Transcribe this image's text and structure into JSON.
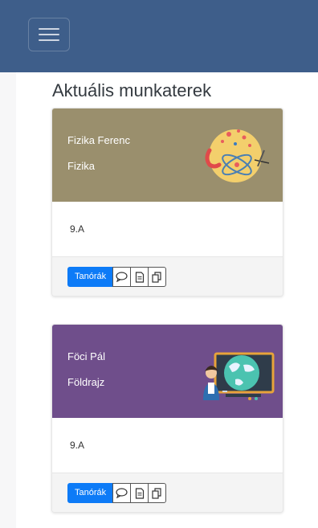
{
  "page_title": "Aktuális munkaterek",
  "cards": [
    {
      "teacher": "Fizika Ferenc",
      "subject": "Fizika",
      "class_name": "9.A",
      "header_color": "#9a8f6d",
      "illustration": "physics-atom-illustration",
      "buttons": {
        "primary": "Tanórák",
        "icons": [
          "chat-icon",
          "document-icon",
          "copy-icon"
        ]
      }
    },
    {
      "teacher": "Föci Pál",
      "subject": "Földrajz",
      "class_name": "9.A",
      "header_color": "#6f4e8b",
      "illustration": "geography-teacher-illustration",
      "buttons": {
        "primary": "Tanórák",
        "icons": [
          "chat-icon",
          "document-icon",
          "copy-icon"
        ]
      }
    }
  ]
}
